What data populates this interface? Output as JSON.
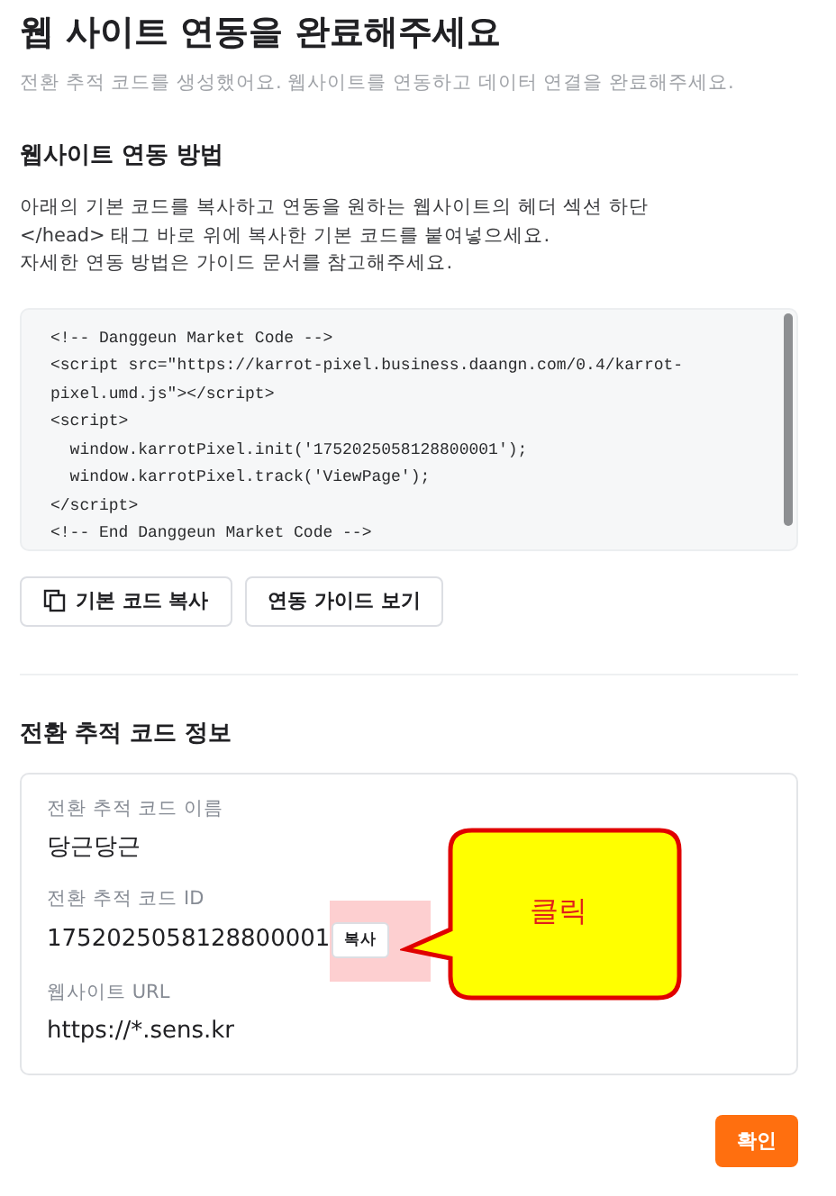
{
  "title": "웹 사이트 연동을 완료해주세요",
  "subtitle": "전환 추적 코드를 생성했어요. 웹사이트를 연동하고 데이터 연결을 완료해주세요.",
  "integration": {
    "heading": "웹사이트 연동 방법",
    "instructions": [
      "아래의 기본 코드를 복사하고 연동을 원하는 웹사이트의 헤더 섹션 하단",
      "</head> 태그 바로 위에 복사한 기본 코드를 붙여넣으세요.",
      "자세한 연동 방법은 가이드 문서를 참고해주세요."
    ],
    "code_lines": [
      "<!-- Danggeun Market Code -->",
      "<script src=\"https://karrot-pixel.business.daangn.com/0.4/karrot-",
      "pixel.umd.js\"></script>",
      "<script>",
      "  window.karrotPixel.init('1752025058128800001');",
      "  window.karrotPixel.track('ViewPage');",
      "</script>",
      "<!-- End Danggeun Market Code -->"
    ],
    "buttons": [
      {
        "label": "기본 코드 복사",
        "kind": "copy"
      },
      {
        "label": "연동 가이드 보기",
        "kind": "plain"
      }
    ]
  },
  "info": {
    "heading": "전환 추적 코드 정보",
    "fields": [
      {
        "label": "전환 추적 코드 이름",
        "value": "당근당근",
        "kind": "text"
      },
      {
        "label": "전환 추적 코드 ID",
        "value": "1752025058128800001",
        "kind": "copyable",
        "button": "복사"
      },
      {
        "label": "웹사이트 URL",
        "value": "https://*.sens.kr",
        "kind": "text"
      }
    ]
  },
  "annotation": {
    "text": "클릭"
  },
  "confirm_button": "확인"
}
